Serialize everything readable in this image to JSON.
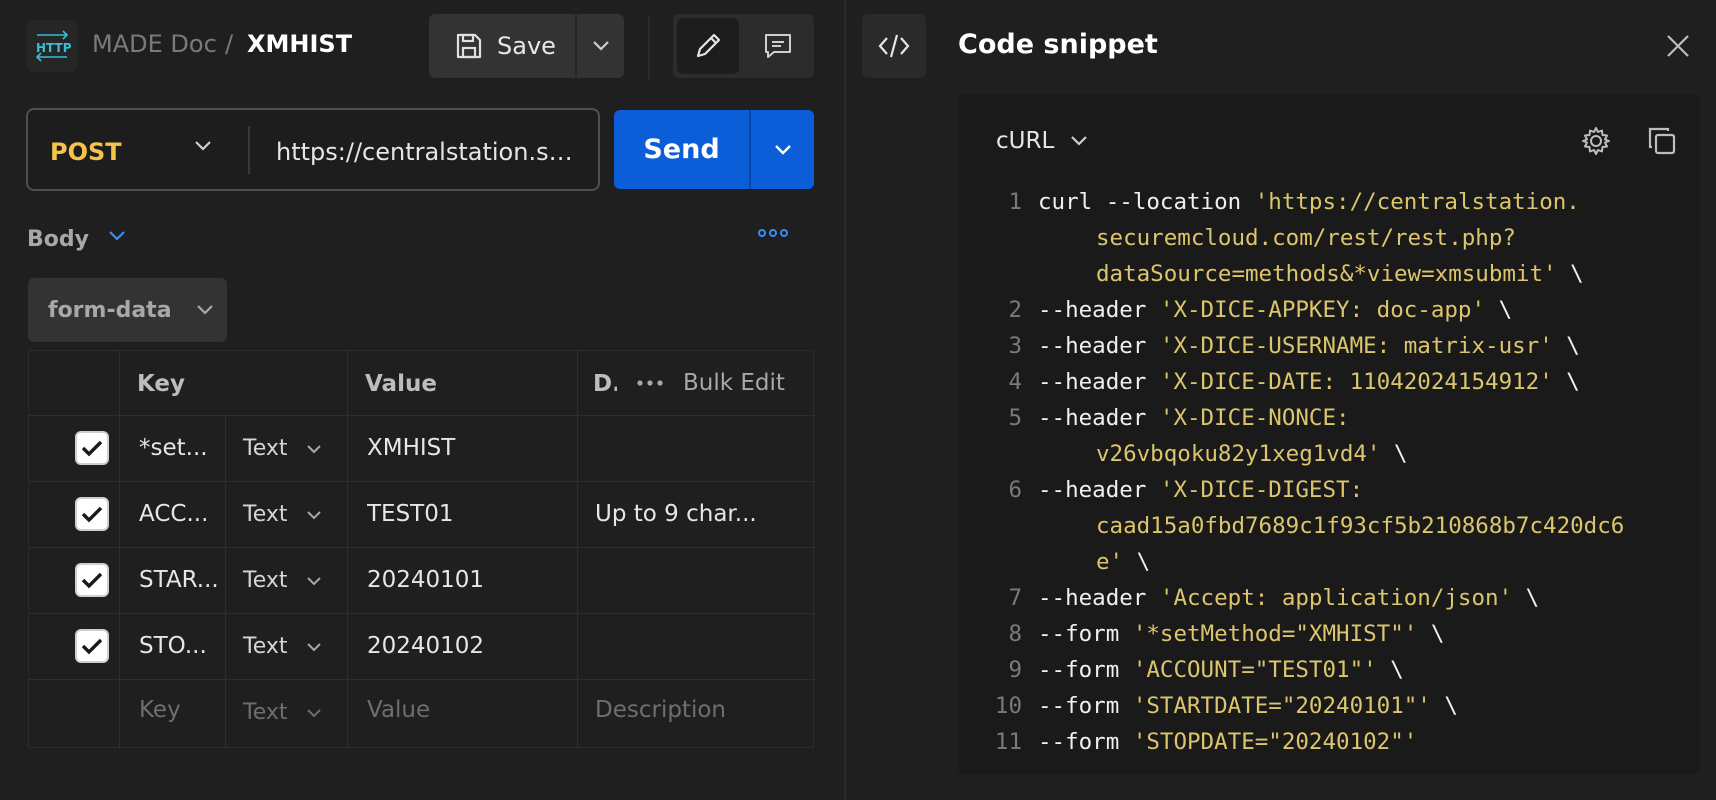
{
  "breadcrumb": {
    "parent": "MADE Doc",
    "separator": "/",
    "current": "XMHIST"
  },
  "toolbar": {
    "save_label": "Save"
  },
  "request": {
    "method": "POST",
    "url": "https://centralstation.securemcloud.com/rest/rest.php?dataSource=methods&*view=xmsubmit",
    "send_label": "Send"
  },
  "body": {
    "label": "Body",
    "mode": "form-data"
  },
  "params_table": {
    "headers": {
      "key": "Key",
      "value": "Value",
      "description": "D.",
      "bulk_edit": "Bulk Edit"
    },
    "rows": [
      {
        "checked": true,
        "key": "*set...",
        "type": "Text",
        "value": "XMHIST",
        "description": ""
      },
      {
        "checked": true,
        "key": "ACC...",
        "type": "Text",
        "value": "TEST01",
        "description": "Up to 9 char..."
      },
      {
        "checked": true,
        "key": "STAR...",
        "type": "Text",
        "value": "20240101",
        "description": ""
      },
      {
        "checked": true,
        "key": "STO...",
        "type": "Text",
        "value": "20240102",
        "description": ""
      }
    ],
    "placeholder": {
      "key": "Key",
      "type": "Text",
      "value": "Value",
      "description": "Description"
    }
  },
  "snippet": {
    "title": "Code snippet",
    "language": "cURL",
    "lines": [
      {
        "n": "1",
        "rows": [
          [
            [
              "p",
              "curl --location "
            ],
            [
              "s",
              "'https://centralstation."
            ]
          ],
          [
            [
              "s",
              "securemcloud.com/rest/rest.php?"
            ]
          ],
          [
            [
              "s",
              "dataSource=methods&*view=xmsubmit'"
            ],
            [
              "p",
              " \\"
            ]
          ]
        ]
      },
      {
        "n": "2",
        "rows": [
          [
            [
              "p",
              "--header "
            ],
            [
              "s",
              "'X-DICE-APPKEY: doc-app'"
            ],
            [
              "p",
              " \\"
            ]
          ]
        ]
      },
      {
        "n": "3",
        "rows": [
          [
            [
              "p",
              "--header "
            ],
            [
              "s",
              "'X-DICE-USERNAME: matrix-usr'"
            ],
            [
              "p",
              " \\"
            ]
          ]
        ]
      },
      {
        "n": "4",
        "rows": [
          [
            [
              "p",
              "--header "
            ],
            [
              "s",
              "'X-DICE-DATE: 11042024154912'"
            ],
            [
              "p",
              " \\"
            ]
          ]
        ]
      },
      {
        "n": "5",
        "rows": [
          [
            [
              "p",
              "--header "
            ],
            [
              "s",
              "'X-DICE-NONCE:"
            ]
          ],
          [
            [
              "s",
              "v26vbqoku82y1xeg1vd4'"
            ],
            [
              "p",
              " \\"
            ]
          ]
        ]
      },
      {
        "n": "6",
        "rows": [
          [
            [
              "p",
              "--header "
            ],
            [
              "s",
              "'X-DICE-DIGEST:"
            ]
          ],
          [
            [
              "s",
              "caad15a0fbd7689c1f93cf5b210868b7c420dc6"
            ]
          ],
          [
            [
              "s",
              "e'"
            ],
            [
              "p",
              " \\"
            ]
          ]
        ]
      },
      {
        "n": "7",
        "rows": [
          [
            [
              "p",
              "--header "
            ],
            [
              "s",
              "'Accept: application/json'"
            ],
            [
              "p",
              " \\"
            ]
          ]
        ]
      },
      {
        "n": "8",
        "rows": [
          [
            [
              "p",
              "--form "
            ],
            [
              "s",
              "'*setMethod=\"XMHIST\"'"
            ],
            [
              "p",
              " \\"
            ]
          ]
        ]
      },
      {
        "n": "9",
        "rows": [
          [
            [
              "p",
              "--form "
            ],
            [
              "s",
              "'ACCOUNT=\"TEST01\"'"
            ],
            [
              "p",
              " \\"
            ]
          ]
        ]
      },
      {
        "n": "10",
        "rows": [
          [
            [
              "p",
              "--form "
            ],
            [
              "s",
              "'STARTDATE=\"20240101\"'"
            ],
            [
              "p",
              " \\"
            ]
          ]
        ]
      },
      {
        "n": "11",
        "rows": [
          [
            [
              "p",
              "--form "
            ],
            [
              "s",
              "'STOPDATE=\"20240102\"'"
            ]
          ]
        ]
      }
    ]
  },
  "colors": {
    "accent": "#0b5ed7",
    "method": "#f5c34a",
    "code_string": "#dcc56c",
    "background": "#1f1f1f"
  },
  "icons": [
    "http-logo-icon",
    "save-icon",
    "chevron-down-icon",
    "pencil-icon",
    "comment-icon",
    "code-icon",
    "close-icon",
    "gear-icon",
    "copy-icon",
    "more-horizontal-icon",
    "checkbox-checked-icon"
  ]
}
